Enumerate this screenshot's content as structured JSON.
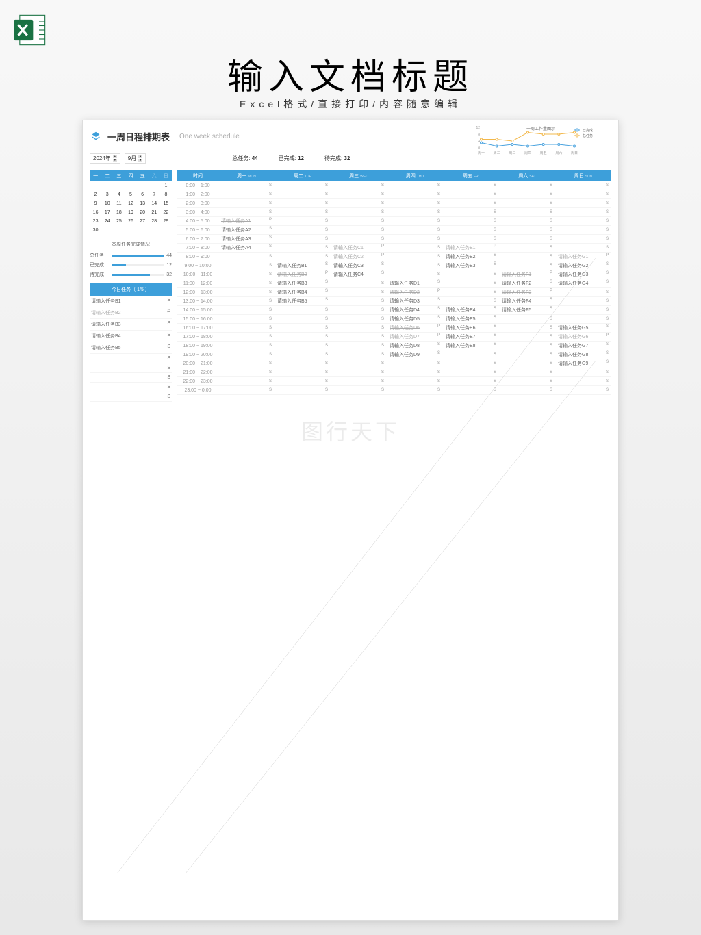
{
  "page": {
    "title": "输入文档标题",
    "subtitle": "Excel格式/直接打印/内容随意编辑"
  },
  "header": {
    "title": "一周日程排期表",
    "title_en": "One week schedule",
    "year": "2024年",
    "month": "9月"
  },
  "summary": {
    "total_label": "总任务:",
    "total": "44",
    "done_label": "已完成:",
    "done": "12",
    "pending_label": "待完成:",
    "pending": "32"
  },
  "chart_data": {
    "type": "line",
    "title": "一周工作量图示",
    "categories": [
      "周一",
      "周二",
      "周三",
      "周四",
      "周五",
      "周六",
      "周日"
    ],
    "series": [
      {
        "name": "已完成",
        "color": "#4aa3df",
        "values": [
          3,
          1,
          2,
          1,
          2,
          2,
          1
        ]
      },
      {
        "name": "总任务",
        "color": "#f2b84b",
        "values": [
          5,
          5,
          4,
          9,
          8,
          8,
          9
        ]
      }
    ],
    "ylim": [
      0,
      12
    ],
    "yticks": [
      0,
      4,
      8,
      12
    ]
  },
  "calendar": {
    "days_header": [
      "一",
      "二",
      "三",
      "四",
      "五",
      "六",
      "日"
    ],
    "rows": [
      [
        "",
        "",
        "",
        "",
        "",
        "",
        "1"
      ],
      [
        "2",
        "3",
        "4",
        "5",
        "6",
        "7",
        "8"
      ],
      [
        "9",
        "10",
        "11",
        "12",
        "13",
        "14",
        "15"
      ],
      [
        "16",
        "17",
        "18",
        "19",
        "20",
        "21",
        "22"
      ],
      [
        "23",
        "24",
        "25",
        "26",
        "27",
        "28",
        "29"
      ],
      [
        "30",
        "",
        "",
        "",
        "",
        "",
        ""
      ]
    ]
  },
  "status": {
    "title": "本周任务完成情况",
    "rows": [
      {
        "label": "总任务",
        "value": "44",
        "pct": 100,
        "color": "#3d9fda"
      },
      {
        "label": "已完成",
        "value": "12",
        "pct": 27,
        "color": "#3d9fda"
      },
      {
        "label": "待完成",
        "value": "32",
        "pct": 73,
        "color": "#3d9fda"
      }
    ]
  },
  "today": {
    "header": "今日任务（ 1/5 ）",
    "items": [
      {
        "text": "请输入任务B1",
        "status": "S",
        "done": false
      },
      {
        "text": "请输入任务B2",
        "status": "P",
        "done": true
      },
      {
        "text": "请输入任务B3",
        "status": "S",
        "done": false
      },
      {
        "text": "请输入任务B4",
        "status": "S",
        "done": false
      },
      {
        "text": "请输入任务B5",
        "status": "S",
        "done": false
      },
      {
        "text": "",
        "status": "S",
        "done": false
      },
      {
        "text": "",
        "status": "S",
        "done": false
      },
      {
        "text": "",
        "status": "S",
        "done": false
      },
      {
        "text": "",
        "status": "S",
        "done": false
      },
      {
        "text": "",
        "status": "S",
        "done": false
      }
    ]
  },
  "schedule": {
    "time_label": "时间",
    "days": [
      {
        "cn": "周一",
        "en": "MON"
      },
      {
        "cn": "周二",
        "en": "TUE"
      },
      {
        "cn": "周三",
        "en": "WED"
      },
      {
        "cn": "周四",
        "en": "THU"
      },
      {
        "cn": "周五",
        "en": "FRI"
      },
      {
        "cn": "周六",
        "en": "SAT"
      },
      {
        "cn": "周日",
        "en": "SUN"
      }
    ],
    "rows": [
      {
        "time": "0:00 ~ 1:00",
        "cells": [
          {
            "t": "",
            "s": "S"
          },
          {
            "t": "",
            "s": "S"
          },
          {
            "t": "",
            "s": "S"
          },
          {
            "t": "",
            "s": "S"
          },
          {
            "t": "",
            "s": "S"
          },
          {
            "t": "",
            "s": "S"
          },
          {
            "t": "",
            "s": "S"
          }
        ]
      },
      {
        "time": "1:00 ~ 2:00",
        "cells": [
          {
            "t": "",
            "s": "S"
          },
          {
            "t": "",
            "s": "S"
          },
          {
            "t": "",
            "s": "S"
          },
          {
            "t": "",
            "s": "S"
          },
          {
            "t": "",
            "s": "S"
          },
          {
            "t": "",
            "s": "S"
          },
          {
            "t": "",
            "s": "S"
          }
        ]
      },
      {
        "time": "2:00 ~ 3:00",
        "cells": [
          {
            "t": "",
            "s": "S"
          },
          {
            "t": "",
            "s": "S"
          },
          {
            "t": "",
            "s": "S"
          },
          {
            "t": "",
            "s": "S"
          },
          {
            "t": "",
            "s": "S"
          },
          {
            "t": "",
            "s": "S"
          },
          {
            "t": "",
            "s": "S"
          }
        ]
      },
      {
        "time": "3:00 ~ 4:00",
        "cells": [
          {
            "t": "",
            "s": "S"
          },
          {
            "t": "",
            "s": "S"
          },
          {
            "t": "",
            "s": "S"
          },
          {
            "t": "",
            "s": "S"
          },
          {
            "t": "",
            "s": "S"
          },
          {
            "t": "",
            "s": "S"
          },
          {
            "t": "",
            "s": "S"
          }
        ]
      },
      {
        "time": "4:00 ~ 5:00",
        "cells": [
          {
            "t": "请输入任务A1",
            "s": "P",
            "d": 1
          },
          {
            "t": "",
            "s": "S"
          },
          {
            "t": "",
            "s": "S"
          },
          {
            "t": "",
            "s": "S"
          },
          {
            "t": "",
            "s": "S"
          },
          {
            "t": "",
            "s": "S"
          },
          {
            "t": "",
            "s": "S"
          }
        ]
      },
      {
        "time": "5:00 ~ 6:00",
        "cells": [
          {
            "t": "请输入任务A2",
            "s": "S"
          },
          {
            "t": "",
            "s": "S"
          },
          {
            "t": "",
            "s": "S"
          },
          {
            "t": "",
            "s": "S"
          },
          {
            "t": "",
            "s": "S"
          },
          {
            "t": "",
            "s": "S"
          },
          {
            "t": "",
            "s": "S"
          }
        ]
      },
      {
        "time": "6:00 ~ 7:00",
        "cells": [
          {
            "t": "请输入任务A3",
            "s": "S"
          },
          {
            "t": "",
            "s": "S"
          },
          {
            "t": "",
            "s": "S"
          },
          {
            "t": "",
            "s": "S"
          },
          {
            "t": "",
            "s": "S"
          },
          {
            "t": "",
            "s": "S"
          },
          {
            "t": "",
            "s": "S"
          }
        ]
      },
      {
        "time": "7:00 ~ 8:00",
        "cells": [
          {
            "t": "请输入任务A4",
            "s": "S"
          },
          {
            "t": "",
            "s": "S"
          },
          {
            "t": "请输入任务C1",
            "s": "P",
            "d": 1
          },
          {
            "t": "",
            "s": "S"
          },
          {
            "t": "请输入任务E1",
            "s": "P",
            "d": 1
          },
          {
            "t": "",
            "s": "S"
          },
          {
            "t": "",
            "s": "S"
          }
        ]
      },
      {
        "time": "8:00 ~ 9:00",
        "cells": [
          {
            "t": "",
            "s": "S"
          },
          {
            "t": "",
            "s": "S"
          },
          {
            "t": "请输入任务C2",
            "s": "P",
            "d": 1
          },
          {
            "t": "",
            "s": "S"
          },
          {
            "t": "请输入任务E2",
            "s": "S"
          },
          {
            "t": "",
            "s": "S"
          },
          {
            "t": "请输入任务G1",
            "s": "P",
            "d": 1
          }
        ]
      },
      {
        "time": "9:00 ~ 10:00",
        "cells": [
          {
            "t": "",
            "s": "S"
          },
          {
            "t": "请输入任务B1",
            "s": "S"
          },
          {
            "t": "请输入任务C3",
            "s": "S"
          },
          {
            "t": "",
            "s": "S"
          },
          {
            "t": "请输入任务E3",
            "s": "S"
          },
          {
            "t": "",
            "s": "S"
          },
          {
            "t": "请输入任务G2",
            "s": "S"
          }
        ]
      },
      {
        "time": "10:00 ~ 11:00",
        "cells": [
          {
            "t": "",
            "s": "S"
          },
          {
            "t": "请输入任务B2",
            "s": "P",
            "d": 1
          },
          {
            "t": "请输入任务C4",
            "s": "S"
          },
          {
            "t": "",
            "s": "S"
          },
          {
            "t": "",
            "s": "S"
          },
          {
            "t": "请输入任务F1",
            "s": "P",
            "d": 1
          },
          {
            "t": "请输入任务G3",
            "s": "S"
          }
        ]
      },
      {
        "time": "11:00 ~ 12:00",
        "cells": [
          {
            "t": "",
            "s": "S"
          },
          {
            "t": "请输入任务B3",
            "s": "S"
          },
          {
            "t": "",
            "s": "S"
          },
          {
            "t": "请输入任务D1",
            "s": "S"
          },
          {
            "t": "",
            "s": "S"
          },
          {
            "t": "请输入任务F2",
            "s": "S"
          },
          {
            "t": "请输入任务G4",
            "s": "S"
          }
        ]
      },
      {
        "time": "12:00 ~ 13:00",
        "cells": [
          {
            "t": "",
            "s": "S"
          },
          {
            "t": "请输入任务B4",
            "s": "S"
          },
          {
            "t": "",
            "s": "S"
          },
          {
            "t": "请输入任务D2",
            "s": "P",
            "d": 1
          },
          {
            "t": "",
            "s": "S"
          },
          {
            "t": "请输入任务F3",
            "s": "P",
            "d": 1
          },
          {
            "t": "",
            "s": "S"
          }
        ]
      },
      {
        "time": "13:00 ~ 14:00",
        "cells": [
          {
            "t": "",
            "s": "S"
          },
          {
            "t": "请输入任务B5",
            "s": "S"
          },
          {
            "t": "",
            "s": "S"
          },
          {
            "t": "请输入任务D3",
            "s": "S"
          },
          {
            "t": "",
            "s": "S"
          },
          {
            "t": "请输入任务F4",
            "s": "S"
          },
          {
            "t": "",
            "s": "S"
          }
        ]
      },
      {
        "time": "14:00 ~ 15:00",
        "cells": [
          {
            "t": "",
            "s": "S"
          },
          {
            "t": "",
            "s": "S"
          },
          {
            "t": "",
            "s": "S"
          },
          {
            "t": "请输入任务D4",
            "s": "S"
          },
          {
            "t": "请输入任务E4",
            "s": "S"
          },
          {
            "t": "请输入任务F5",
            "s": "S"
          },
          {
            "t": "",
            "s": "S"
          }
        ]
      },
      {
        "time": "15:00 ~ 16:00",
        "cells": [
          {
            "t": "",
            "s": "S"
          },
          {
            "t": "",
            "s": "S"
          },
          {
            "t": "",
            "s": "S"
          },
          {
            "t": "请输入任务D5",
            "s": "S"
          },
          {
            "t": "请输入任务E5",
            "s": "S"
          },
          {
            "t": "",
            "s": "S"
          },
          {
            "t": "",
            "s": "S"
          }
        ]
      },
      {
        "time": "16:00 ~ 17:00",
        "cells": [
          {
            "t": "",
            "s": "S"
          },
          {
            "t": "",
            "s": "S"
          },
          {
            "t": "",
            "s": "S"
          },
          {
            "t": "请输入任务D6",
            "s": "P",
            "d": 1
          },
          {
            "t": "请输入任务E6",
            "s": "S"
          },
          {
            "t": "",
            "s": "S"
          },
          {
            "t": "请输入任务G5",
            "s": "S"
          }
        ]
      },
      {
        "time": "17:00 ~ 18:00",
        "cells": [
          {
            "t": "",
            "s": "S"
          },
          {
            "t": "",
            "s": "S"
          },
          {
            "t": "",
            "s": "S"
          },
          {
            "t": "请输入任务D7",
            "s": "P",
            "d": 1
          },
          {
            "t": "请输入任务E7",
            "s": "S"
          },
          {
            "t": "",
            "s": "S"
          },
          {
            "t": "请输入任务G6",
            "s": "P",
            "d": 1
          }
        ]
      },
      {
        "time": "18:00 ~ 19:00",
        "cells": [
          {
            "t": "",
            "s": "S"
          },
          {
            "t": "",
            "s": "S"
          },
          {
            "t": "",
            "s": "S"
          },
          {
            "t": "请输入任务D8",
            "s": "S"
          },
          {
            "t": "请输入任务E8",
            "s": "S"
          },
          {
            "t": "",
            "s": "S"
          },
          {
            "t": "请输入任务G7",
            "s": "S"
          }
        ]
      },
      {
        "time": "19:00 ~ 20:00",
        "cells": [
          {
            "t": "",
            "s": "S"
          },
          {
            "t": "",
            "s": "S"
          },
          {
            "t": "",
            "s": "S"
          },
          {
            "t": "请输入任务D9",
            "s": "S"
          },
          {
            "t": "",
            "s": "S"
          },
          {
            "t": "",
            "s": "S"
          },
          {
            "t": "请输入任务G8",
            "s": "S"
          }
        ]
      },
      {
        "time": "20:00 ~ 21:00",
        "cells": [
          {
            "t": "",
            "s": "S"
          },
          {
            "t": "",
            "s": "S"
          },
          {
            "t": "",
            "s": "S"
          },
          {
            "t": "",
            "s": "S"
          },
          {
            "t": "",
            "s": "S"
          },
          {
            "t": "",
            "s": "S"
          },
          {
            "t": "请输入任务G9",
            "s": "S"
          }
        ]
      },
      {
        "time": "21:00 ~ 22:00",
        "cells": [
          {
            "t": "",
            "s": "S"
          },
          {
            "t": "",
            "s": "S"
          },
          {
            "t": "",
            "s": "S"
          },
          {
            "t": "",
            "s": "S"
          },
          {
            "t": "",
            "s": "S"
          },
          {
            "t": "",
            "s": "S"
          },
          {
            "t": "",
            "s": "S"
          }
        ]
      },
      {
        "time": "22:00 ~ 23:00",
        "cells": [
          {
            "t": "",
            "s": "S"
          },
          {
            "t": "",
            "s": "S"
          },
          {
            "t": "",
            "s": "S"
          },
          {
            "t": "",
            "s": "S"
          },
          {
            "t": "",
            "s": "S"
          },
          {
            "t": "",
            "s": "S"
          },
          {
            "t": "",
            "s": "S"
          }
        ]
      },
      {
        "time": "23:00 ~ 0:00",
        "cells": [
          {
            "t": "",
            "s": "S"
          },
          {
            "t": "",
            "s": "S"
          },
          {
            "t": "",
            "s": "S"
          },
          {
            "t": "",
            "s": "S"
          },
          {
            "t": "",
            "s": "S"
          },
          {
            "t": "",
            "s": "S"
          },
          {
            "t": "",
            "s": "S"
          }
        ]
      }
    ]
  },
  "watermark": "图行天下"
}
